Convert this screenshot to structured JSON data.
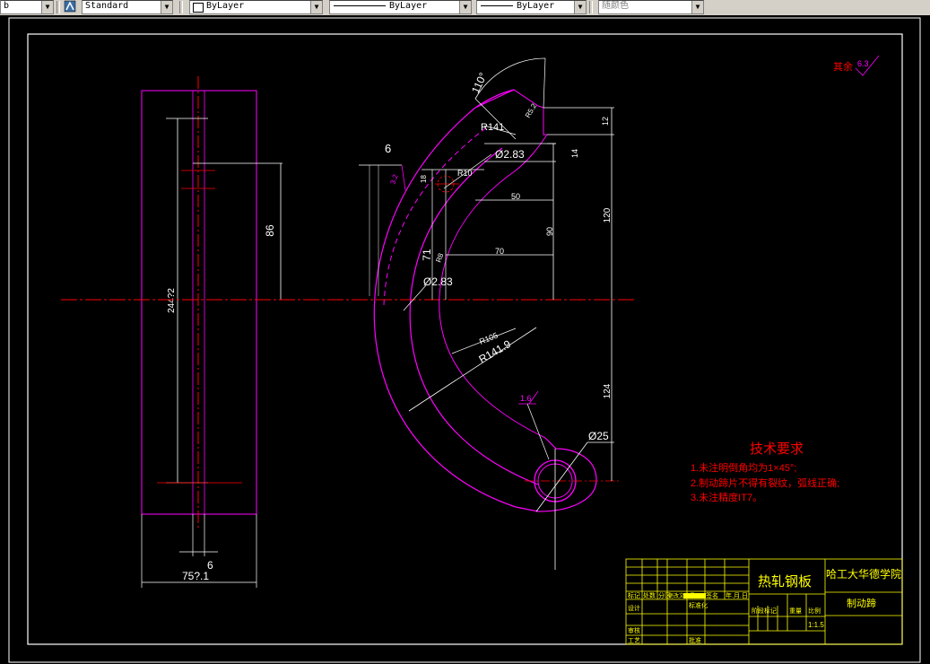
{
  "toolbar": {
    "left_cut_text": "b",
    "text_style": "Standard",
    "layer": "ByLayer",
    "linetype": "ByLayer",
    "lineweight": "ByLayer",
    "plot_color": "随颜色"
  },
  "drawing": {
    "left_view": {
      "dim_height": "244?2",
      "dim_width": "75?.1",
      "dim_slot": "6"
    },
    "main_view": {
      "dim_angle": "110°",
      "dim_r141_top": "R141",
      "dim_dia_top": "Ø2.83",
      "dim_dia_left": "Ø2.83",
      "dim_6": "6",
      "dim_50": "50",
      "dim_70": "70",
      "dim_90": "90",
      "dim_120": "120",
      "dim_124": "124",
      "dim_12": "12",
      "dim_14": "14",
      "dim_71": "71",
      "dim_86": "86",
      "dim_r105": "R105",
      "dim_r141_9": "R141.9",
      "dim_dia25": "Ø25",
      "dim_r10": "R10",
      "dim_r5_2": "R5.2",
      "dim_small_a": "3.2",
      "dim_small_b": "18",
      "dim_small_c": "R8",
      "roughness_inner": "1.6",
      "roughness_other": "其余",
      "roughness_other_val": "6.3"
    },
    "tech_req": {
      "title": "技术要求",
      "items": [
        "1.未注明倒角均为1×45°;",
        "2.制动蹄片不得有裂纹，弧线正确;",
        "3.未注精度IT7。"
      ]
    },
    "title_block": {
      "material": "热轧钢板",
      "school": "哈工大华德学院",
      "part_name": "制动蹄",
      "scale": "1:1.5",
      "row_labels": [
        "标记",
        "处数",
        "分区",
        "更改文件号",
        "签名",
        "年.月.日"
      ],
      "design": "设计",
      "standardize": "标准化",
      "review": "审核",
      "process": "工艺",
      "approve": "批准",
      "stage": "阶段标记",
      "weight": "重量",
      "ratio": "比例"
    },
    "colors": {
      "background": "#000000",
      "frame": "#ffffff",
      "outline": "#ff00ff",
      "center_line": "#ff0000",
      "title_block": "#ffff00",
      "red_text": "#ff0000"
    }
  }
}
